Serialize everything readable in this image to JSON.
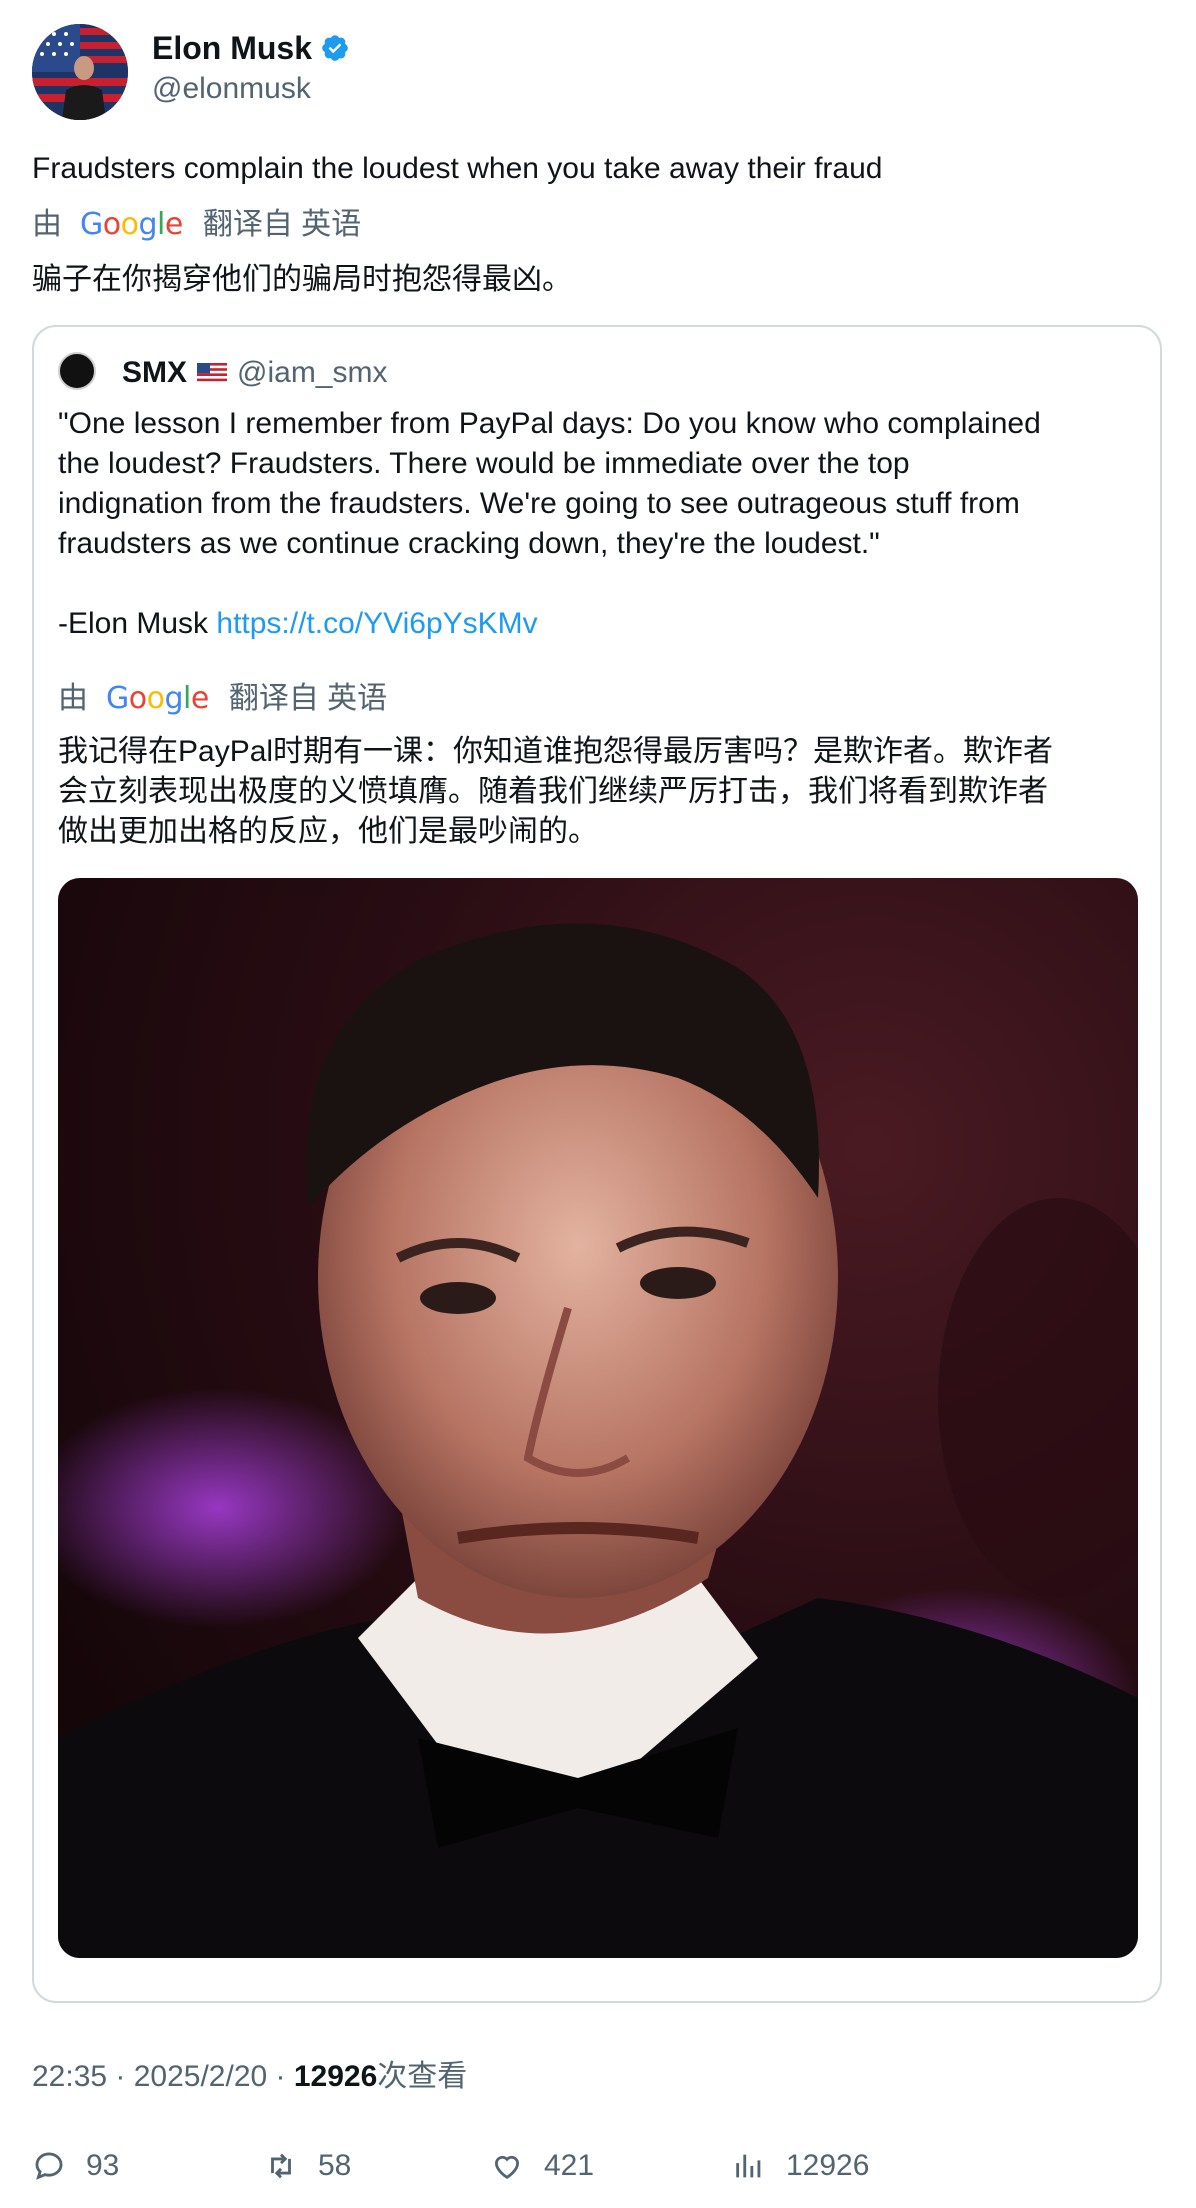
{
  "author": {
    "name": "Elon Musk",
    "handle": "@elonmusk",
    "verified_color": "#1d9bf0"
  },
  "tweet": {
    "text": "Fraudsters complain the loudest when you take away their fraud",
    "translation_by": "由",
    "translation_provider": "Google",
    "translation_from": "翻译自 英语",
    "translated_text": "骗子在你揭穿他们的骗局时抱怨得最凶。"
  },
  "quote": {
    "name": "SMX",
    "flag_icon": "us-flag-icon",
    "handle": "@iam_smx",
    "body_lines": [
      "\"One lesson I remember from PayPal days: Do you know who complained",
      "the loudest? Fraudsters. There would be immediate over the top",
      "indignation from the fraudsters. We're going to see outrageous stuff from",
      "fraudsters as we continue cracking down, they're the loudest.\""
    ],
    "signoff": "-Elon Musk ",
    "link": "https://t.co/YVi6pYsKMv",
    "translation_by": "由",
    "translation_provider": "Google",
    "translation_from": "翻译自 英语",
    "translated_lines": [
      "我记得在PayPal时期有一课：你知道谁抱怨得最厉害吗？是欺诈者。欺诈者",
      "会立刻表现出极度的义愤填膺。随着我们继续严厉打击，我们将看到欺诈者",
      "做出更加出格的反应，他们是最吵闹的。"
    ]
  },
  "meta": {
    "time_date": "22:35 · 2025/2/20 · ",
    "views_count": "12926",
    "views_label": "次查看"
  },
  "actions": {
    "replies": "93",
    "retweets": "58",
    "likes": "421",
    "views": "12926"
  },
  "colors": {
    "link": "#1d9bf0",
    "secondary_text": "#536471",
    "border": "#cfd9de"
  }
}
